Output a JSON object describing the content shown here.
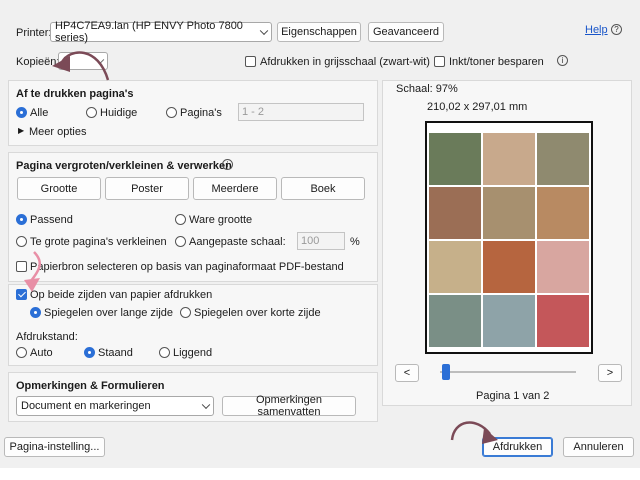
{
  "header": {
    "printer_label": "Printer:",
    "printer_value": "HP4C7EA9.lan (HP ENVY Photo 7800 series)",
    "properties_button": "Eigenschappen",
    "advanced_button": "Geavanceerd",
    "help_link": "Help",
    "copies_label": "Kopieën:",
    "copies_value": "2",
    "grayscale_label": "Afdrukken in grijsschaal (zwart-wit)",
    "save_ink_label": "Inkt/toner besparen"
  },
  "pages_to_print": {
    "title": "Af te drukken pagina's",
    "all": "Alle",
    "current": "Huidige",
    "pages": "Pagina's",
    "range_value": "1 - 2",
    "more_options": "Meer opties"
  },
  "sizing": {
    "title": "Pagina vergroten/verkleinen & verwerken",
    "tabs": [
      "Grootte",
      "Poster",
      "Meerdere",
      "Boek"
    ],
    "fit": "Passend",
    "actual_size": "Ware grootte",
    "shrink_oversized": "Te grote pagina's verkleinen",
    "custom_scale": "Aangepaste schaal:",
    "scale_value": "100",
    "percent": "%",
    "pdf_source": "Papierbron selecteren op basis van paginaformaat PDF-bestand"
  },
  "duplex": {
    "both_sides": "Op beide zijden van papier afdrukken",
    "long_edge": "Spiegelen over lange zijde",
    "short_edge": "Spiegelen over korte zijde",
    "orientation_label": "Afdrukstand:",
    "auto": "Auto",
    "portrait": "Staand",
    "landscape": "Liggend"
  },
  "comments": {
    "title": "Opmerkingen & Formulieren",
    "select_value": "Document en markeringen",
    "summarize_button": "Opmerkingen samenvatten"
  },
  "preview": {
    "scale": "Schaal:  97%",
    "dimensions": "210,02 x 297,01 mm",
    "prev": "<",
    "next": ">",
    "page_indicator": "Pagina 1 van 2",
    "slider_position": 0
  },
  "footer": {
    "page_setup": "Pagina-instelling...",
    "print": "Afdrukken",
    "cancel": "Annuleren"
  },
  "colors": {
    "accent": "#2b6fd6",
    "annotation_arrow": "#7b4a57"
  }
}
